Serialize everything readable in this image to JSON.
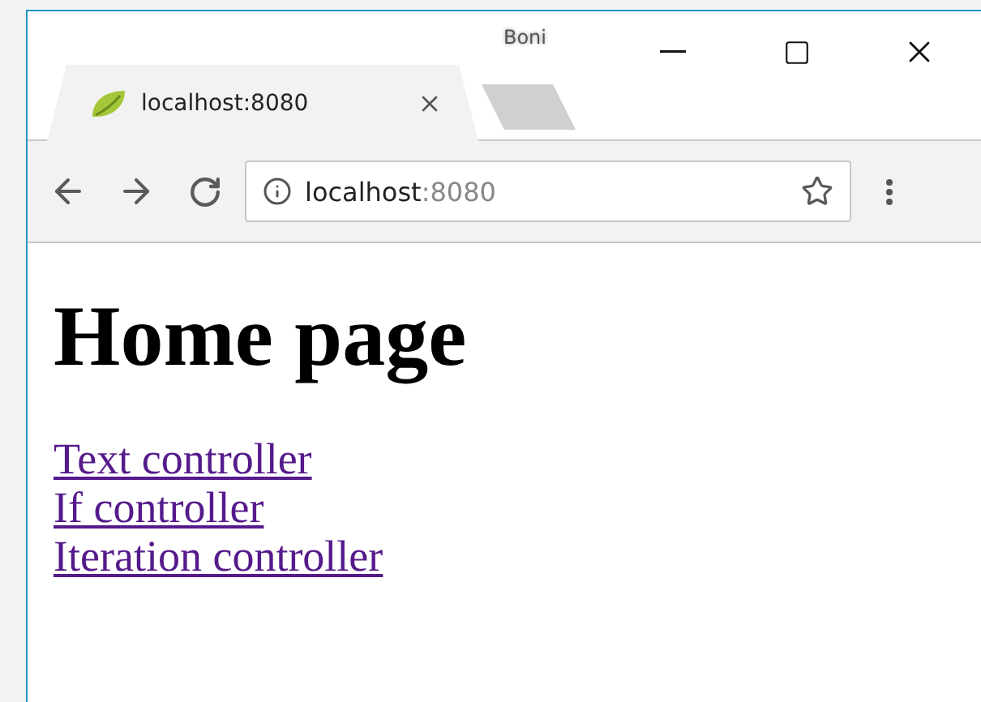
{
  "window": {
    "user": "Boni"
  },
  "tabs": [
    {
      "title": "localhost:8080",
      "selected": true
    }
  ],
  "toolbar": {
    "address": {
      "host": "localhost",
      "port": ":8080"
    }
  },
  "page": {
    "heading": "Home page",
    "links": [
      {
        "label": "Text controller"
      },
      {
        "label": "If controller"
      },
      {
        "label": "Iteration controller"
      }
    ]
  }
}
